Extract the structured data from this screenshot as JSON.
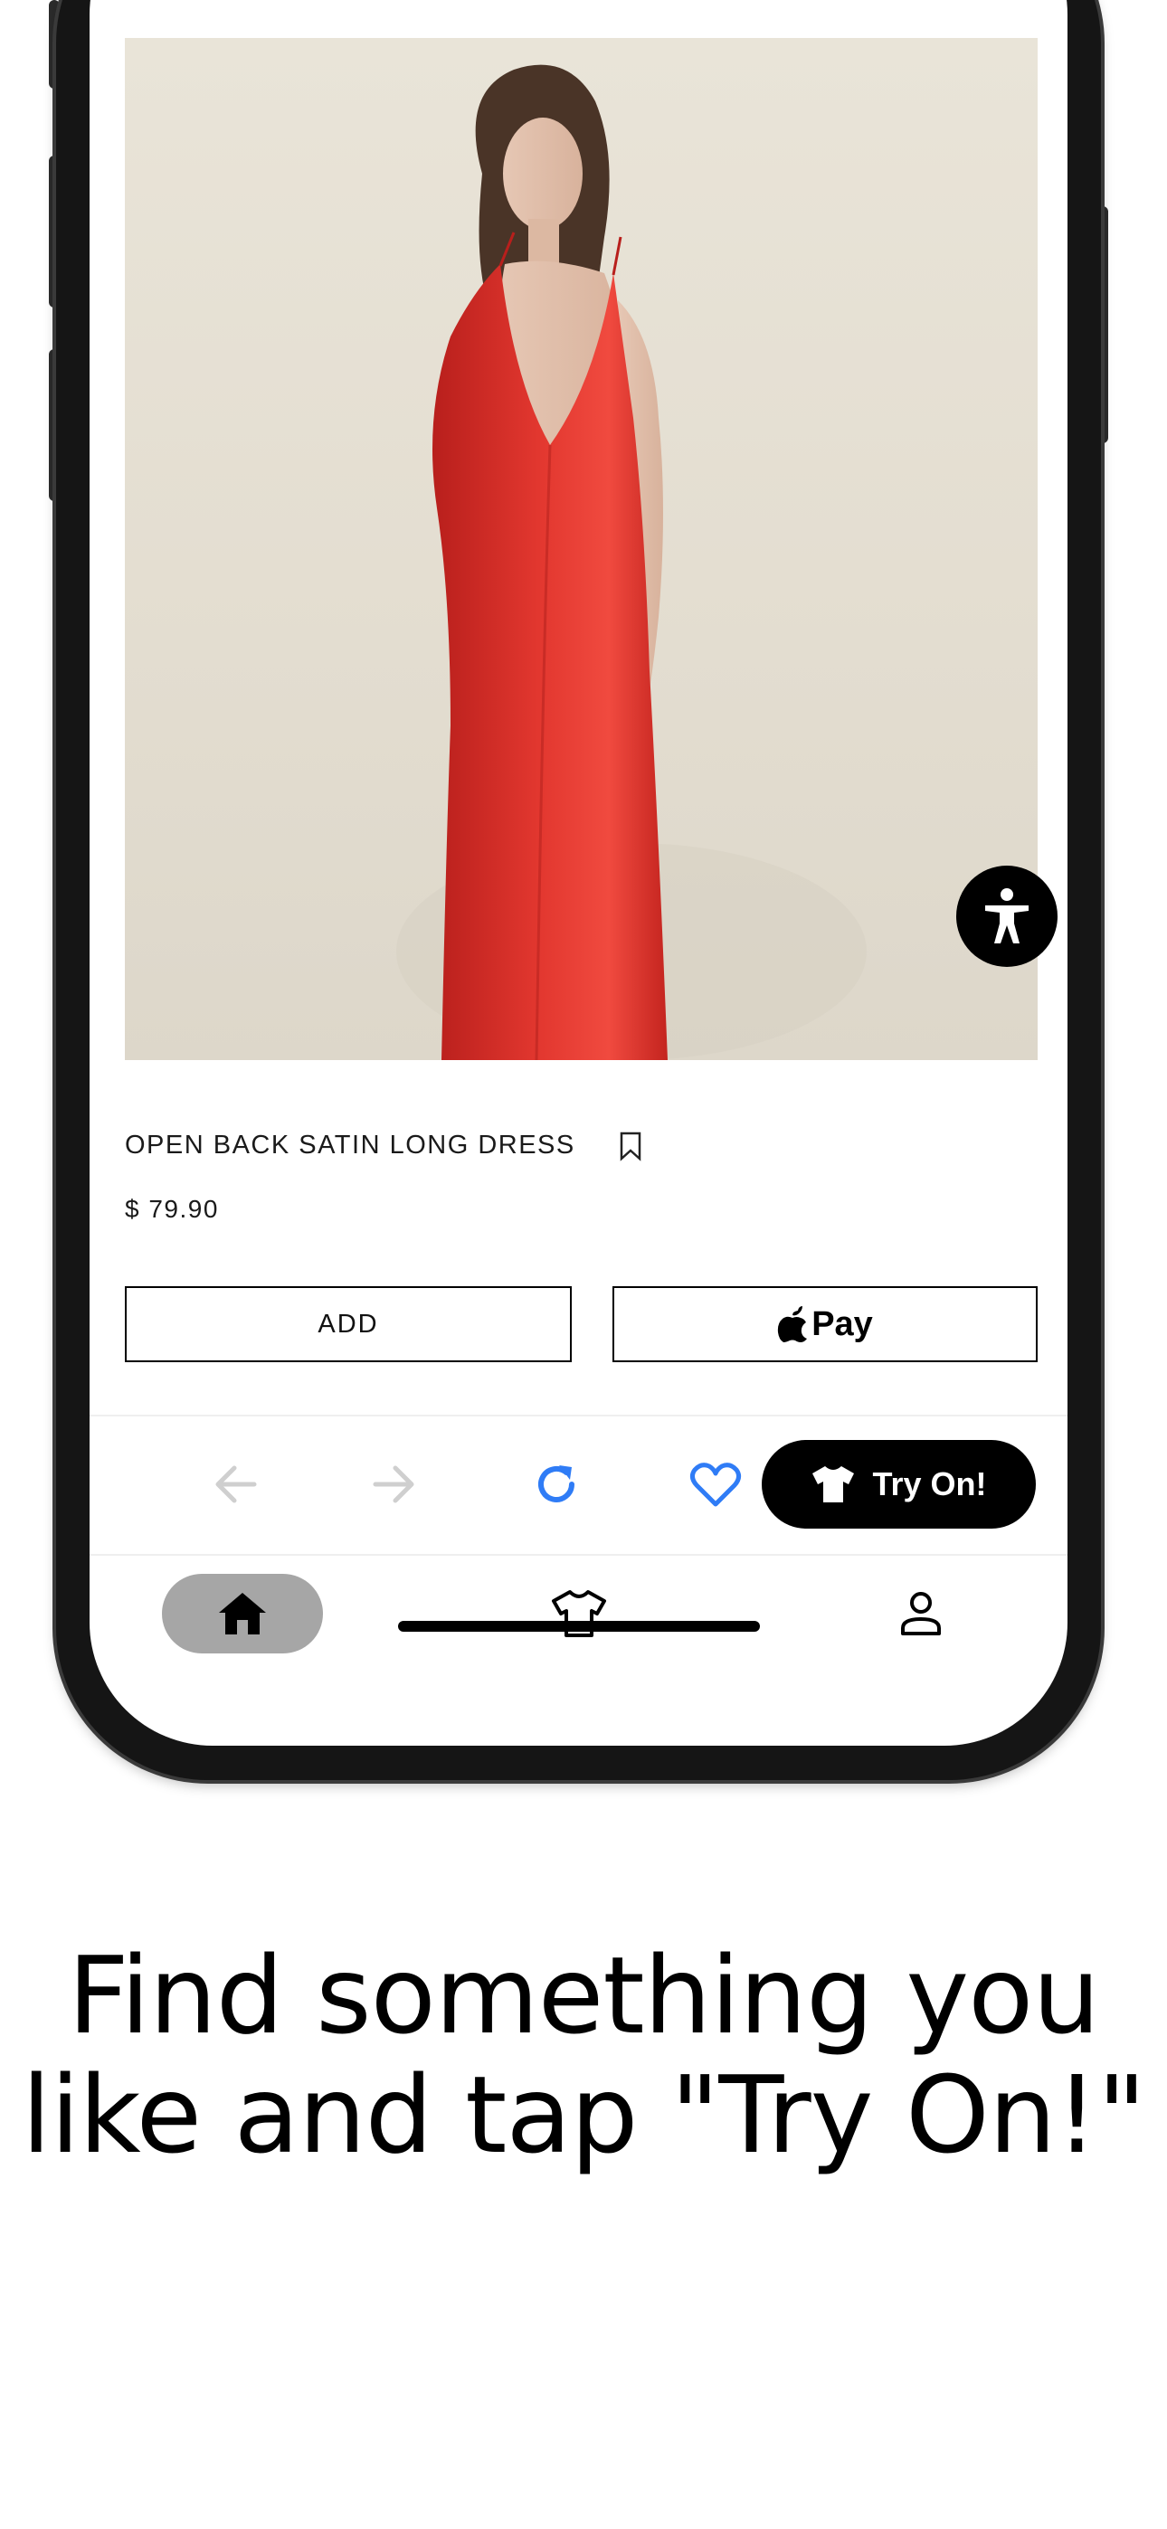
{
  "product": {
    "title": "OPEN BACK SATIN LONG DRESS",
    "price": "$ 79.90"
  },
  "actions": {
    "add_label": "ADD",
    "applepay_label": "Pay"
  },
  "browser_nav": {
    "back_icon": "arrow-left-icon",
    "forward_icon": "arrow-right-icon",
    "refresh_icon": "refresh-icon",
    "favorite_icon": "heart-icon",
    "tryon_label": "Try On!"
  },
  "tabs": [
    {
      "icon": "home-icon",
      "active": true
    },
    {
      "icon": "tshirt-icon",
      "active": false
    },
    {
      "icon": "person-icon",
      "active": false
    }
  ],
  "caption": {
    "line1": "Find something you",
    "line2": "like and tap \"Try On!\""
  },
  "colors": {
    "accent_blue": "#2f7cf6",
    "disabled_gray": "#cfcfcf",
    "dress_red": "#d9302a",
    "backdrop": "#e6e0d4"
  }
}
